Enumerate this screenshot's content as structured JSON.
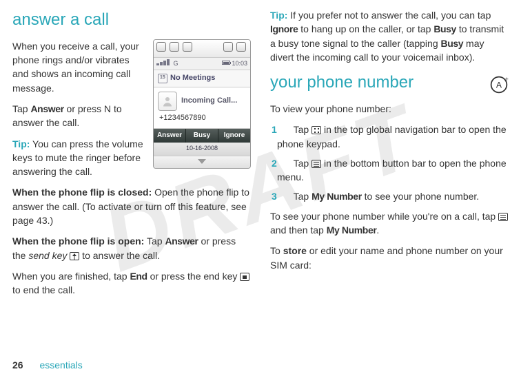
{
  "watermark": "DRAFT",
  "left": {
    "heading": "answer a call",
    "intro1": "When you receive a call, your phone rings and/or vibrates and shows an incoming call message.",
    "intro2_a": "Tap ",
    "intro2_btn": "Answer",
    "intro2_b": " or press N to answer the call.",
    "tip_label": "Tip:",
    "tip_text": " You can press the volume keys to mute the ringer before answering the call.",
    "flipclosed_label": "When the phone flip is closed:",
    "flipclosed_text": " Open the phone flip to answer the call. (To activate or turn off this feature, see page 43.)",
    "flipopen_label": "When the phone flip is open:",
    "flipopen_a": " Tap ",
    "flipopen_btn": "Answer",
    "flipopen_b": " or press the ",
    "flipopen_sendkey": "send key",
    "flipopen_c": " to answer the call.",
    "finish_a": "When you are finished, tap ",
    "finish_btn": "End",
    "finish_b": " or press the end key ",
    "finish_c": " to end the call."
  },
  "phone": {
    "clock": "10:03",
    "no_meetings": "No Meetings",
    "incoming": "Incoming Call...",
    "number": "+1234567890",
    "btn_answer": "Answer",
    "btn_busy": "Busy",
    "btn_ignore": "Ignore",
    "date": "10-16-2008"
  },
  "right": {
    "tip_label": "Tip:",
    "tip_a": " If you prefer not to answer the call, you can tap ",
    "tip_ignore": "Ignore",
    "tip_b": " to hang up on the caller, or tap ",
    "tip_busy1": "Busy",
    "tip_c": " to transmit a busy tone signal to the caller (tapping ",
    "tip_busy2": "Busy",
    "tip_d": " may divert the incoming call to your voicemail inbox).",
    "heading": "your phone number",
    "intro": "To view your phone number:",
    "step1": "in the top global navigation bar to open the phone keypad.",
    "step1_pre": "Tap ",
    "step2_pre": "Tap ",
    "step2": "in the bottom button bar to open the phone menu.",
    "step3_pre": "Tap ",
    "step3_btn": "My Number",
    "step3_post": " to see your phone number.",
    "oncall_a": "To see your phone number while you're on a call, tap ",
    "oncall_b": " and then tap ",
    "oncall_btn": "My Number",
    "oncall_c": ".",
    "store_a": "To ",
    "store_btn": "store",
    "store_b": " or edit your name and phone number on your SIM card:"
  },
  "footer": {
    "page": "26",
    "section": "essentials"
  }
}
